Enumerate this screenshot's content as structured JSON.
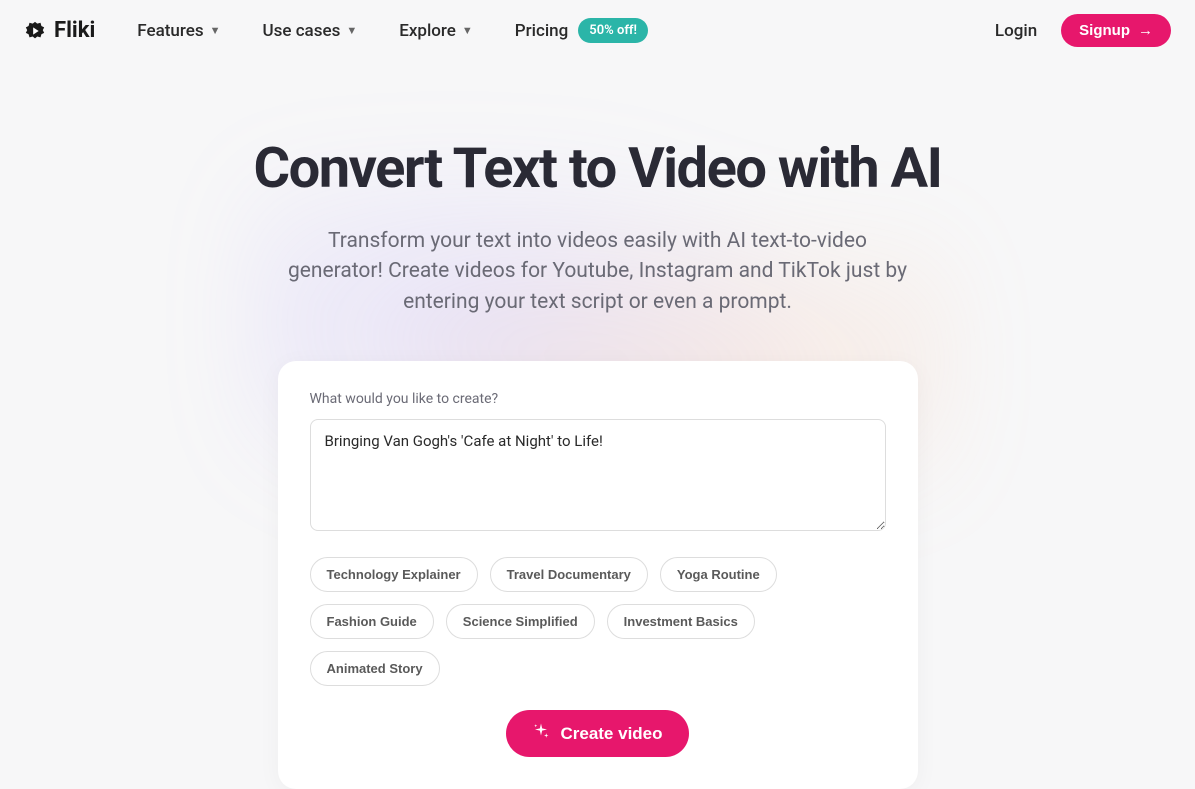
{
  "header": {
    "logo_text": "Fliki",
    "nav": {
      "features": "Features",
      "use_cases": "Use cases",
      "explore": "Explore",
      "pricing": "Pricing",
      "pricing_badge": "50% off!"
    },
    "login": "Login",
    "signup": "Signup"
  },
  "hero": {
    "title": "Convert Text to Video with AI",
    "subtitle": "Transform your text into videos easily with AI text-to-video generator! Create videos for Youtube, Instagram and TikTok just by entering your text script or even a prompt."
  },
  "card": {
    "label": "What would you like to create?",
    "textarea_value": "Bringing Van Gogh's 'Cafe at Night' to Life!",
    "chips": [
      "Technology Explainer",
      "Travel Documentary",
      "Yoga Routine",
      "Fashion Guide",
      "Science Simplified",
      "Investment Basics",
      "Animated Story"
    ],
    "create_button": "Create video"
  }
}
